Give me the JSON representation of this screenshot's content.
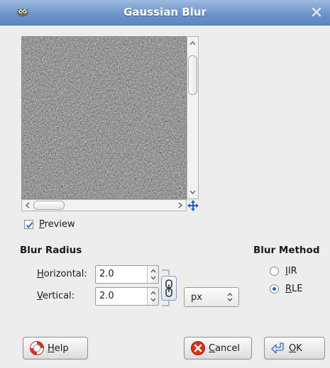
{
  "window": {
    "title": "Gaussian Blur",
    "app_icon": "gimp-wilber-icon",
    "close_icon": "close-icon"
  },
  "preview": {
    "checkbox_label_mnemonic": "P",
    "checkbox_label_rest": "review",
    "checked": true
  },
  "blur_radius": {
    "title": "Blur Radius",
    "horizontal": {
      "label_mnemonic": "H",
      "label_rest": "orizontal:",
      "value": "2.0"
    },
    "vertical": {
      "label_mnemonic": "V",
      "label_rest": "ertical:",
      "value": "2.0"
    },
    "unit": "px",
    "chain_icon": "chain-link-icon"
  },
  "blur_method": {
    "title": "Blur Method",
    "options": [
      {
        "mnemonic": "I",
        "rest": "IR",
        "selected": false
      },
      {
        "mnemonic": "R",
        "rest": "LE",
        "selected": true
      }
    ]
  },
  "buttons": {
    "help": {
      "mnemonic": "H",
      "rest": "elp",
      "icon": "lifebuoy-icon"
    },
    "cancel": {
      "mnemonic": "C",
      "rest": "ancel",
      "icon": "cancel-icon"
    },
    "ok": {
      "mnemonic": "O",
      "rest": "K",
      "icon": "ok-arrow-icon"
    }
  },
  "colors": {
    "titlebar": "#6f95c9",
    "accent": "#2a5fae",
    "cancel_red": "#d7301f"
  }
}
